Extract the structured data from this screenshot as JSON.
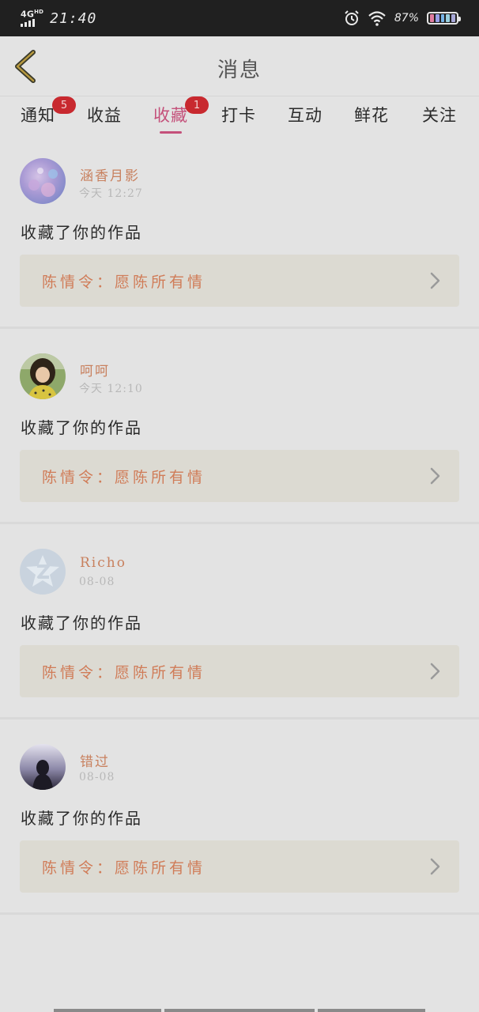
{
  "status_bar": {
    "network": "4G",
    "network_sup": "HD",
    "time": "21:40",
    "battery": "87%"
  },
  "nav": {
    "title": "消息",
    "back_icon": "chevron-left-icon"
  },
  "tabs": [
    {
      "label": "通知",
      "badge": "5",
      "active": false
    },
    {
      "label": "收益",
      "badge": "",
      "active": false
    },
    {
      "label": "收藏",
      "badge": "1",
      "active": true
    },
    {
      "label": "打卡",
      "badge": "",
      "active": false
    },
    {
      "label": "互动",
      "badge": "",
      "active": false
    },
    {
      "label": "鲜花",
      "badge": "",
      "active": false
    },
    {
      "label": "关注",
      "badge": "",
      "active": false
    }
  ],
  "colors": {
    "accent": "#c4507a",
    "badge": "#c8292f",
    "username": "#c8805e",
    "work_title": "#d07c58"
  },
  "messages": [
    {
      "username": "涵香月影",
      "time": "今天 12:27",
      "action": "收藏了你的作品",
      "work": "陈情令：愿陈所有情",
      "avatar": "purple-bokeh-avatar"
    },
    {
      "username": "呵呵",
      "time": "今天 12:10",
      "action": "收藏了你的作品",
      "work": "陈情令：愿陈所有情",
      "avatar": "girl-photo-avatar"
    },
    {
      "username": "Richo",
      "time": "08-08",
      "action": "收藏了你的作品",
      "work": "陈情令：愿陈所有情",
      "avatar": "default-star-avatar"
    },
    {
      "username": "错过",
      "time": "08-08",
      "action": "收藏了你的作品",
      "work": "陈情令：愿陈所有情",
      "avatar": "night-silhouette-avatar"
    }
  ]
}
